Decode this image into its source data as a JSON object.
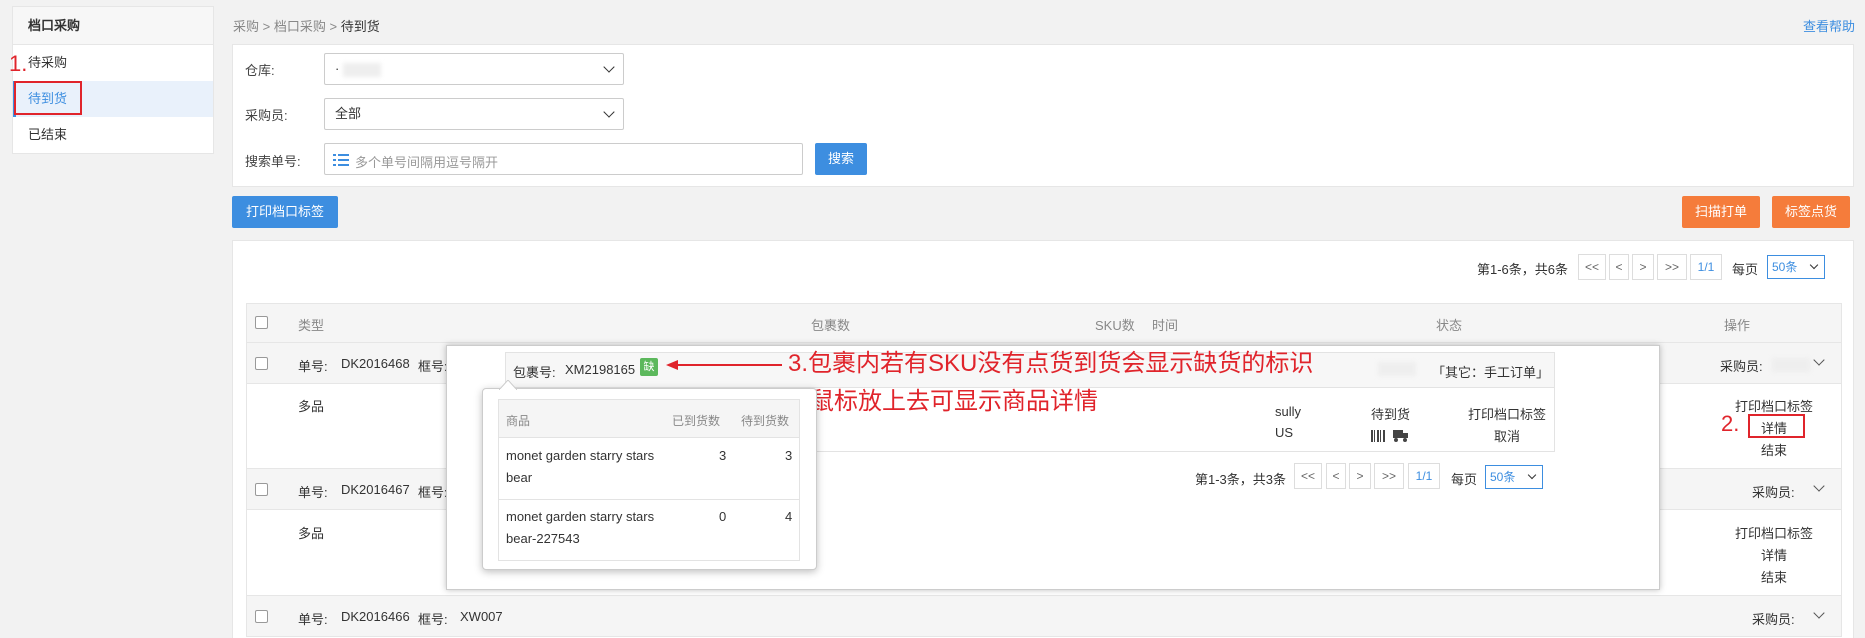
{
  "sidebar": {
    "title": "档口采购",
    "items": [
      {
        "label": "待采购"
      },
      {
        "label": "待到货"
      },
      {
        "label": "已结束"
      }
    ]
  },
  "annotations": {
    "num1": "1.",
    "num2": "2.",
    "text3_line1": "3.包裹内若有SKU没有点货到货会显示缺货的标识",
    "text3_line2": "鼠标放上去可显示商品详情"
  },
  "breadcrumb": {
    "items": [
      "采购",
      "档口采购",
      "待到货"
    ],
    "sep": ">"
  },
  "help_link": "查看帮助",
  "filter": {
    "warehouse_label": "仓库:",
    "warehouse_value": "·",
    "buyer_label": "采购员:",
    "buyer_value": "全部",
    "search_label": "搜索单号:",
    "search_placeholder": "多个单号间隔用逗号隔开",
    "search_button": "搜索"
  },
  "toolbar": {
    "print_label": "打印档口标签",
    "scan_print": "扫描打单",
    "tag_count": "标签点货"
  },
  "pager": {
    "summary": "第1-6条，共6条",
    "first": "<<",
    "prev": "<",
    "next": ">",
    "last": ">>",
    "page": "1/1",
    "per_page_label": "每页",
    "per_page_value": "50条"
  },
  "table": {
    "headers": [
      "类型",
      "包裹数",
      "SKU数",
      "时间",
      "状态",
      "操作"
    ],
    "order_no_label": "单号:",
    "frame_no_label": "框号:",
    "buyer_label": "采购员:",
    "orders": [
      {
        "order_no": "DK2016468",
        "type": "多品",
        "frame_no": "",
        "actions": [
          "打印档口标签",
          "详情",
          "结束"
        ]
      },
      {
        "order_no": "DK2016467",
        "type": "多品",
        "frame_no": "",
        "actions": [
          "打印档口标签",
          "详情",
          "结束"
        ]
      },
      {
        "order_no": "DK2016466",
        "type": "",
        "frame_no": "XW007",
        "actions": []
      }
    ]
  },
  "popover": {
    "package_label": "包裹号:",
    "package_no": "XM2198165",
    "shortage_tag": "缺",
    "other_tag": "「其它：手工订单」",
    "name": "sully",
    "country": "US",
    "status": "待到货",
    "print_label": "打印档口标签",
    "cancel": "取消",
    "pager_summary": "第1-3条，共3条",
    "pager_page": "1/1",
    "per_page_label": "每页",
    "per_page_value": "50条"
  },
  "tooltip": {
    "headers": [
      "商品",
      "已到货数",
      "待到货数"
    ],
    "rows": [
      {
        "name_line1": "monet garden starry stars",
        "name_line2": "bear",
        "arrived": "3",
        "pending": "3"
      },
      {
        "name_line1": "monet garden starry stars",
        "name_line2": "bear-227543",
        "arrived": "0",
        "pending": "4"
      }
    ]
  },
  "colors": {
    "accent": "#3d8ee0",
    "orange": "#f57c3b",
    "annotation_red": "#e0242b",
    "shortage_green": "#5cb85c"
  }
}
